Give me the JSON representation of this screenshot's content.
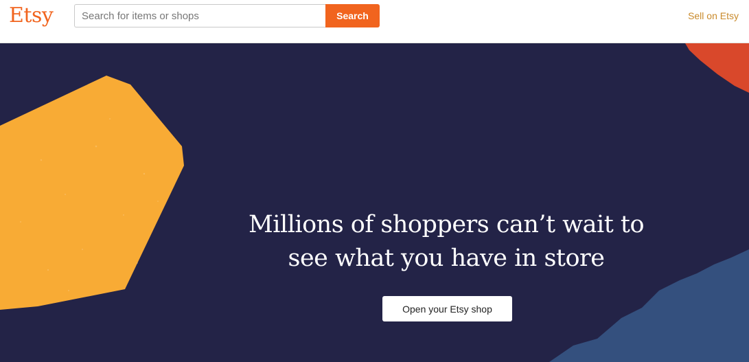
{
  "header": {
    "logo_text": "Etsy",
    "search": {
      "placeholder": "Search for items or shops",
      "value": "",
      "button_label": "Search"
    },
    "sell_link": "Sell on Etsy"
  },
  "hero": {
    "headline_line1": "Millions of shoppers can’t wait to",
    "headline_line2": "see what you have in store",
    "cta_label": "Open your Etsy shop"
  },
  "colors": {
    "brand_orange": "#f1641e",
    "hero_background": "#232347",
    "shape_yellow": "#f8ab35",
    "shape_red": "#d9482b",
    "shape_blue": "#34507e"
  }
}
